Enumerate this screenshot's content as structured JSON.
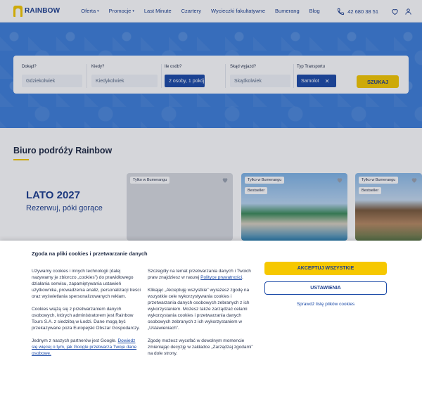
{
  "header": {
    "logo_text": "RAINBOW",
    "nav": [
      {
        "label": "Oferta",
        "has_caret": true
      },
      {
        "label": "Promocje",
        "has_caret": true
      },
      {
        "label": "Last Minute",
        "has_caret": false
      },
      {
        "label": "Czartery",
        "has_caret": false
      },
      {
        "label": "Wycieczki fakultatywne",
        "has_caret": false
      },
      {
        "label": "Bumerang",
        "has_caret": false
      },
      {
        "label": "Blog",
        "has_caret": false
      }
    ],
    "phone": "42 680 38 51",
    "caret_glyph": "▾"
  },
  "search": {
    "where_label": "Dokąd?",
    "where_value": "Gdziekolwiek",
    "when_label": "Kiedy?",
    "when_value": "Kiedykolwiek",
    "who_label": "Ile osób?",
    "who_value": "2 osoby, 1 pokój",
    "from_label": "Skąd wyjazd?",
    "from_value": "Skądkolwiek",
    "transport_label": "Typ Transportu",
    "transport_value": "Samolot",
    "clear_glyph": "✕",
    "search_button": "SZUKAJ"
  },
  "main": {
    "section_title": "Biuro podróży Rainbow",
    "promo_title": "LATO 2027",
    "promo_subtitle": "Rezerwuj, póki gorące",
    "cards": [
      {
        "tag": "Tylko w Bumerangu",
        "badge": ""
      },
      {
        "tag": "Tylko w Bumerangu",
        "badge": "Bestseller"
      },
      {
        "tag": "Tylko w Bumerangu",
        "badge": "Bestseller"
      }
    ]
  },
  "cookie": {
    "title": "Zgoda na pliki cookies i przetwarzanie danych",
    "col1": [
      "Używamy cookies i innych technologii (dalej nazywamy je zbiorczo „cookies”) do prawidłowego działania serwisu, zapamiętywania ustawień użytkownika, prowadzenia analiz, personalizacji treści oraz wyświetlania spersonalizowanych reklam.",
      "Cookies wiążą się z przetwarzaniem danych osobowych, których administratorem jest Rainbow Tours S.A. z siedzibą w Łodzi. Dane mogą być przekazywane poza Europejski Obszar Gospodarczy.",
      "Jednym z naszych partnerów jest Google."
    ],
    "col1_link": "Dowiedz się więcej o tym, jak Google przetwarza Twoje dane osobowe.",
    "col2_p1_pre": "Szczegóły na temat przetwarzania danych i Twoich praw znajdziesz w naszej",
    "col2_p1_link": "Polityce prywatności",
    "col2_p1_post": ".",
    "col2": [
      "Klikając „Akceptuję wszystkie” wyrażasz zgodę na wszystkie cele wykorzystywania cookies i przetwarzania danych osobowych zebranych z ich wykorzystaniem. Możesz także zarządzać celami wykorzystania cookies i przetwarzania danych osobowych zebranych z ich wykorzystaniem w „Ustawieniach”.",
      "Zgodę możesz wycofać w dowolnym momencie zmieniając decyzję w zakładce „Zarządzaj zgodami” na dole strony."
    ],
    "accept_button": "AKCEPTUJ WSZYSTKIE",
    "settings_button": "USTAWIENIA",
    "list_link": "Sprawdź listę plików cookies"
  },
  "colors": {
    "brand_blue": "#1d3f8f",
    "brand_yellow": "#f6c800",
    "hero_blue": "#3f7fd9"
  }
}
